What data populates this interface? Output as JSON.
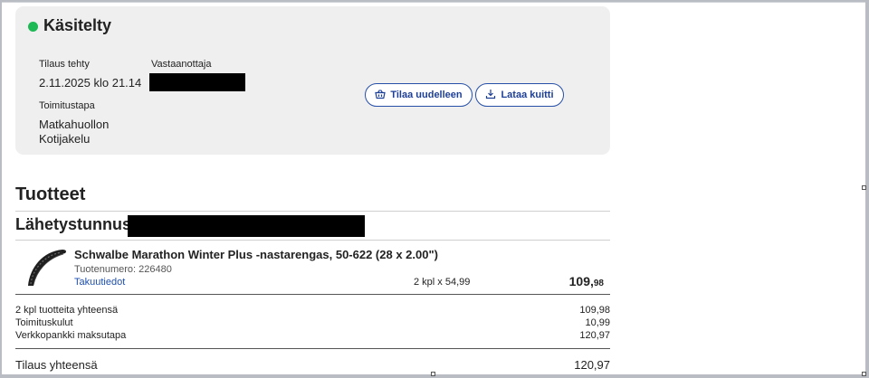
{
  "status": {
    "title": "Käsitelty",
    "color": "#1db954"
  },
  "order": {
    "date_label": "Tilaus tehty",
    "date_value": "2.11.2025 klo 21.14",
    "recipient_label": "Vastaanottaja",
    "delivery_label": "Toimitustapa",
    "delivery_value_line1": "Matkahuollon",
    "delivery_value_line2": "Kotijakelu"
  },
  "actions": {
    "reorder_label": "Tilaa uudelleen",
    "reorder_icon": "basket-icon",
    "receipt_label": "Lataa kuitti",
    "receipt_icon": "download-icon"
  },
  "products": {
    "title": "Tuotteet",
    "shipment_label": "Lähetystunnus",
    "items": [
      {
        "name": "Schwalbe Marathon Winter Plus -nastarengas, 50-622 (28 x 2.00\")",
        "code": "Tuotenumero: 226480",
        "warranty_link": "Takuutiedot",
        "quantity": "2 kpl x 54,99",
        "price_main": "109,",
        "price_decimal": "98",
        "image": "bicycle-tire"
      }
    ]
  },
  "summary": {
    "rows": [
      {
        "label": "2 kpl tuotteita yhteensä",
        "value": "109,98"
      },
      {
        "label": "Toimituskulut",
        "value": "10,99"
      },
      {
        "label": "Verkkopankki maksutapa",
        "value": "120,97"
      }
    ],
    "total_label": "Tilaus yhteensä",
    "total_value": "120,97"
  }
}
